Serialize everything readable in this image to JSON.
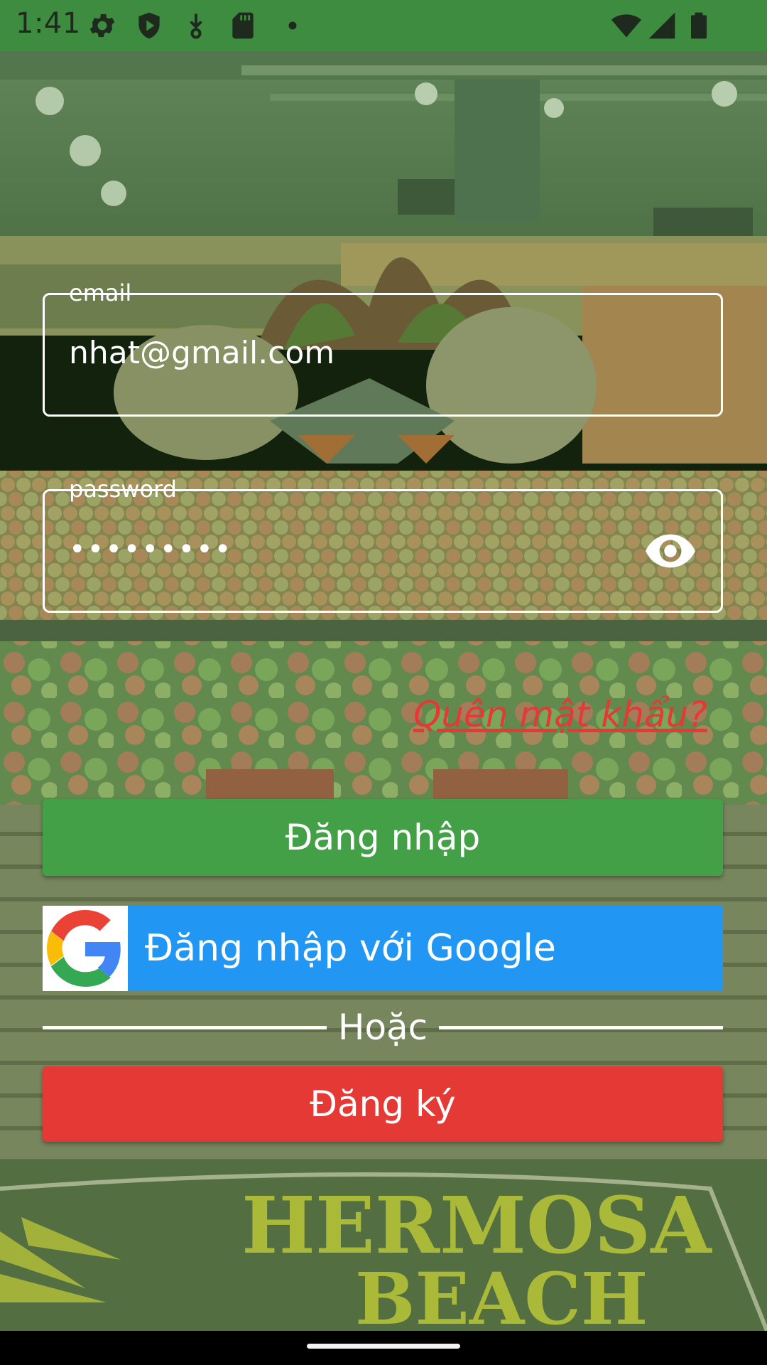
{
  "status_bar": {
    "time": "1:41",
    "left_icons": [
      "settings-icon",
      "play-protect-icon",
      "download-icon",
      "sd-card-icon",
      "dot-icon"
    ],
    "right_icons": [
      "wifi-icon",
      "signal-icon",
      "battery-icon"
    ]
  },
  "form": {
    "email": {
      "label": "email",
      "value": "nhat@gmail.com"
    },
    "password": {
      "label": "password",
      "value": "•••••••••",
      "toggle_icon": "eye-icon"
    },
    "forgot_password": "Quên mật khẩu?"
  },
  "buttons": {
    "login": "Đăng nhập",
    "google_login": "Đăng nhập với Google",
    "google_icon": "google-logo-icon",
    "divider_text": "Hoặc",
    "register": "Đăng ký"
  },
  "background": {
    "sign_text_line1": "HERMOSA",
    "sign_text_line2": "BEACH"
  },
  "colors": {
    "status_bar": "#3d8c40",
    "login_button": "#43a047",
    "google_button": "#2196f3",
    "register_button": "#e53935",
    "forgot_link": "#e53935"
  }
}
